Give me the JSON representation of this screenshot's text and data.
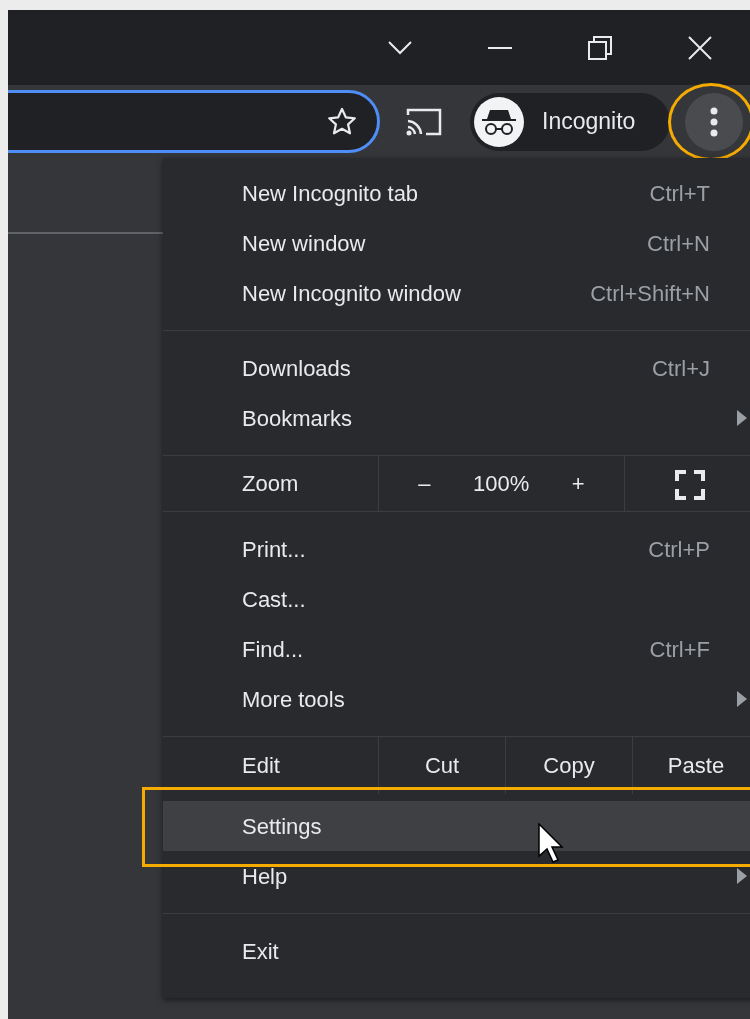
{
  "toolbar": {
    "bookmarked": false,
    "profile": {
      "label": "Incognito"
    },
    "menu_button": {
      "annotated": true
    }
  },
  "menu": {
    "sections": [
      {
        "items": [
          {
            "kind": "item",
            "label": "New Incognito tab",
            "shortcut": "Ctrl+T",
            "submenu": false,
            "selected": false,
            "annotated": false
          },
          {
            "kind": "item",
            "label": "New window",
            "shortcut": "Ctrl+N",
            "submenu": false,
            "selected": false,
            "annotated": false
          },
          {
            "kind": "item",
            "label": "New Incognito window",
            "shortcut": "Ctrl+Shift+N",
            "submenu": false,
            "selected": false,
            "annotated": false
          }
        ]
      },
      {
        "items": [
          {
            "kind": "item",
            "label": "Downloads",
            "shortcut": "Ctrl+J",
            "submenu": false,
            "selected": false,
            "annotated": false
          },
          {
            "kind": "item",
            "label": "Bookmarks",
            "submenu": true,
            "selected": false,
            "annotated": false
          }
        ]
      },
      {
        "items": [
          {
            "kind": "zoom",
            "label": "Zoom",
            "minus": "–",
            "value": "100%",
            "plus": "+"
          }
        ]
      },
      {
        "items": [
          {
            "kind": "item",
            "label": "Print...",
            "shortcut": "Ctrl+P",
            "submenu": false,
            "selected": false,
            "annotated": false
          },
          {
            "kind": "item",
            "label": "Cast...",
            "submenu": false,
            "selected": false,
            "annotated": false
          },
          {
            "kind": "item",
            "label": "Find...",
            "shortcut": "Ctrl+F",
            "submenu": false,
            "selected": false,
            "annotated": false
          },
          {
            "kind": "item",
            "label": "More tools",
            "submenu": true,
            "selected": false,
            "annotated": false
          }
        ]
      },
      {
        "items": [
          {
            "kind": "edit",
            "label": "Edit",
            "buttons": [
              "Cut",
              "Copy",
              "Paste"
            ]
          },
          {
            "kind": "item",
            "label": "Settings",
            "submenu": false,
            "selected": true,
            "annotated": true
          },
          {
            "kind": "item",
            "label": "Help",
            "submenu": true,
            "selected": false,
            "annotated": false
          }
        ]
      },
      {
        "items": [
          {
            "kind": "item",
            "label": "Exit",
            "submenu": false,
            "selected": false,
            "annotated": false
          }
        ]
      }
    ]
  }
}
